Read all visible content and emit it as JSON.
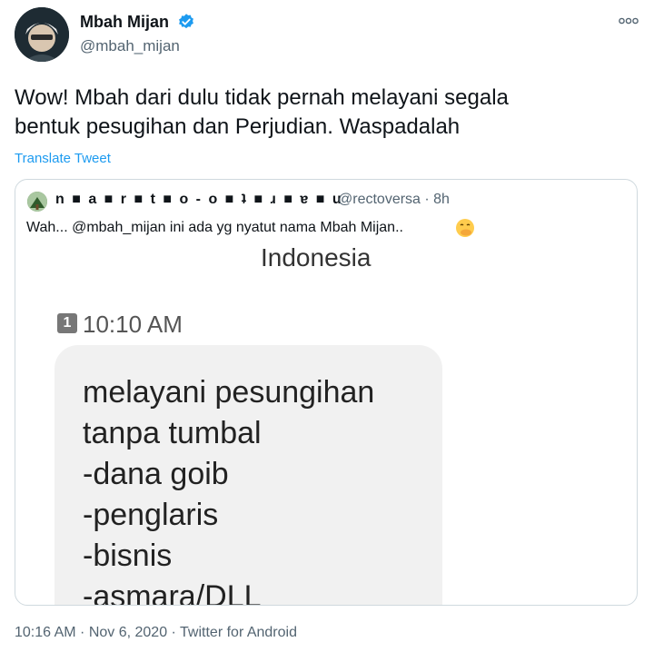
{
  "tweet": {
    "author_name": "Mbah Mijan",
    "author_handle": "@mbah_mijan",
    "text_line1": "Wow! Mbah dari dulu tidak pernah melayani segala",
    "text_line2": "bentuk pesugihan dan Perjudian. Waspadalah",
    "translate_label": "Translate Tweet",
    "footer": "10:16 AM · Nov 6, 2020 · Twitter for Android",
    "icons": {
      "verified": "verified-badge-icon",
      "more": "more-options-icon"
    },
    "colors": {
      "accent": "#1d9bf0",
      "secondary_text": "#536471",
      "border": "#cfd9de"
    }
  },
  "quote": {
    "author_name": "n ■ a ■ r ■ t ■ o - o ■ ʇ ■ ɹ ■ ɐ ■ u",
    "author_meta": "@rectoversa · 8h",
    "text": "Wah... @mbah_mijan ini ada yg nyatut nama Mbah Mijan..",
    "emoji": "🤭",
    "media": {
      "header": "Indonesia",
      "sim_label": "1",
      "time": "10:10 AM",
      "message_lines": [
        "melayani pesungihan",
        "tanpa tumbal",
        "-dana goib",
        "-penglaris",
        "-bisnis",
        "-asmara/DLL"
      ]
    }
  }
}
